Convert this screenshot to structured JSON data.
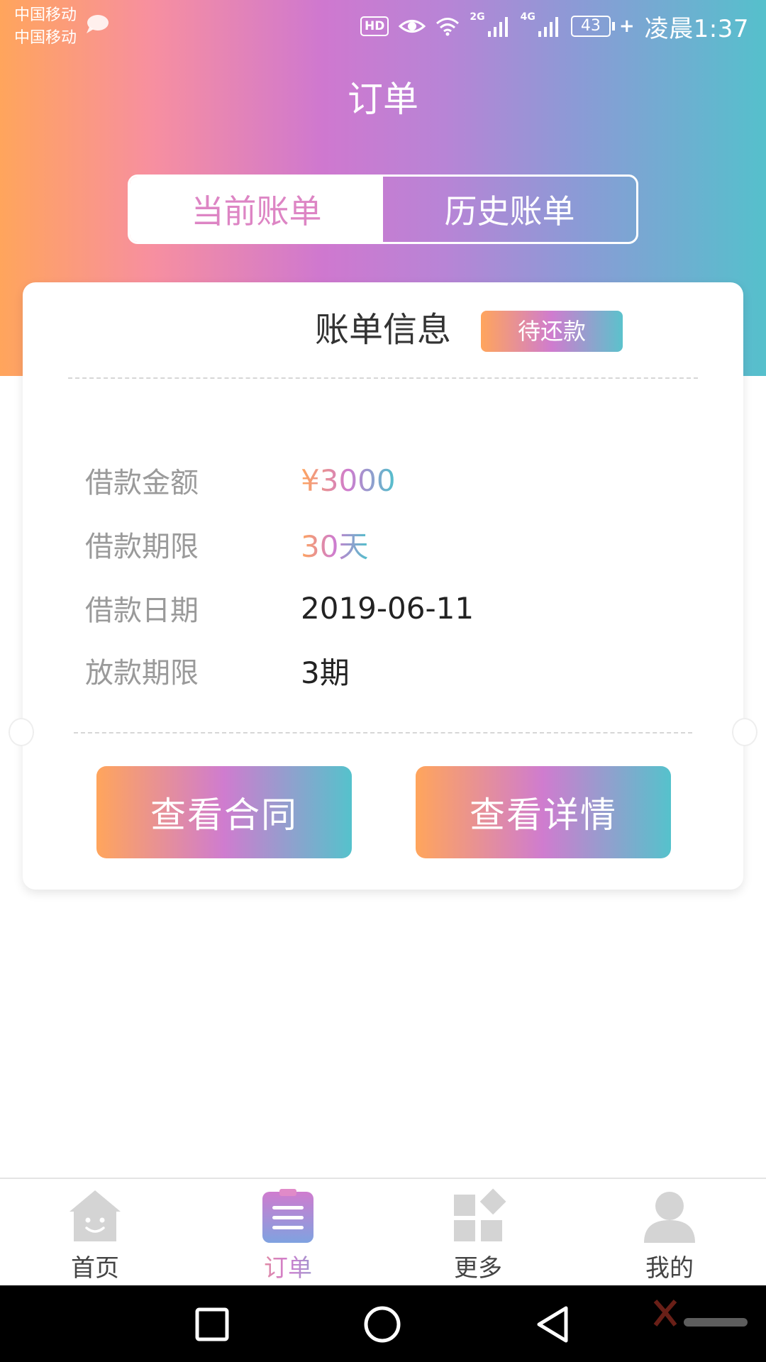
{
  "status_bar": {
    "carrier_1": "中国移动",
    "carrier_2": "中国移动",
    "hd": "HD",
    "network_1": "2G",
    "network_2": "4G",
    "battery": "43",
    "time": "凌晨1:37"
  },
  "header": {
    "title": "订单"
  },
  "tabs": {
    "current": "当前账单",
    "history": "历史账单"
  },
  "bill_card": {
    "title": "账单信息",
    "status": "待还款",
    "rows": [
      {
        "label": "借款金额",
        "value": "¥3000"
      },
      {
        "label": "借款期限",
        "value": "30天"
      },
      {
        "label": "借款日期",
        "value": "2019-06-11"
      },
      {
        "label": "放款期限",
        "value": "3期"
      }
    ],
    "contract_button": "查看合同",
    "detail_button": "查看详情"
  },
  "bottom_nav": {
    "items": [
      {
        "label": "首页",
        "icon": "home-icon"
      },
      {
        "label": "订单",
        "icon": "order-icon",
        "active": true
      },
      {
        "label": "更多",
        "icon": "more-icon"
      },
      {
        "label": "我的",
        "icon": "profile-icon"
      }
    ]
  },
  "colors": {
    "gradient_start": "#ffa55c",
    "gradient_mid": "#cf7ccf",
    "gradient_end": "#55c2cc",
    "label_gray": "#9a9a9a"
  }
}
